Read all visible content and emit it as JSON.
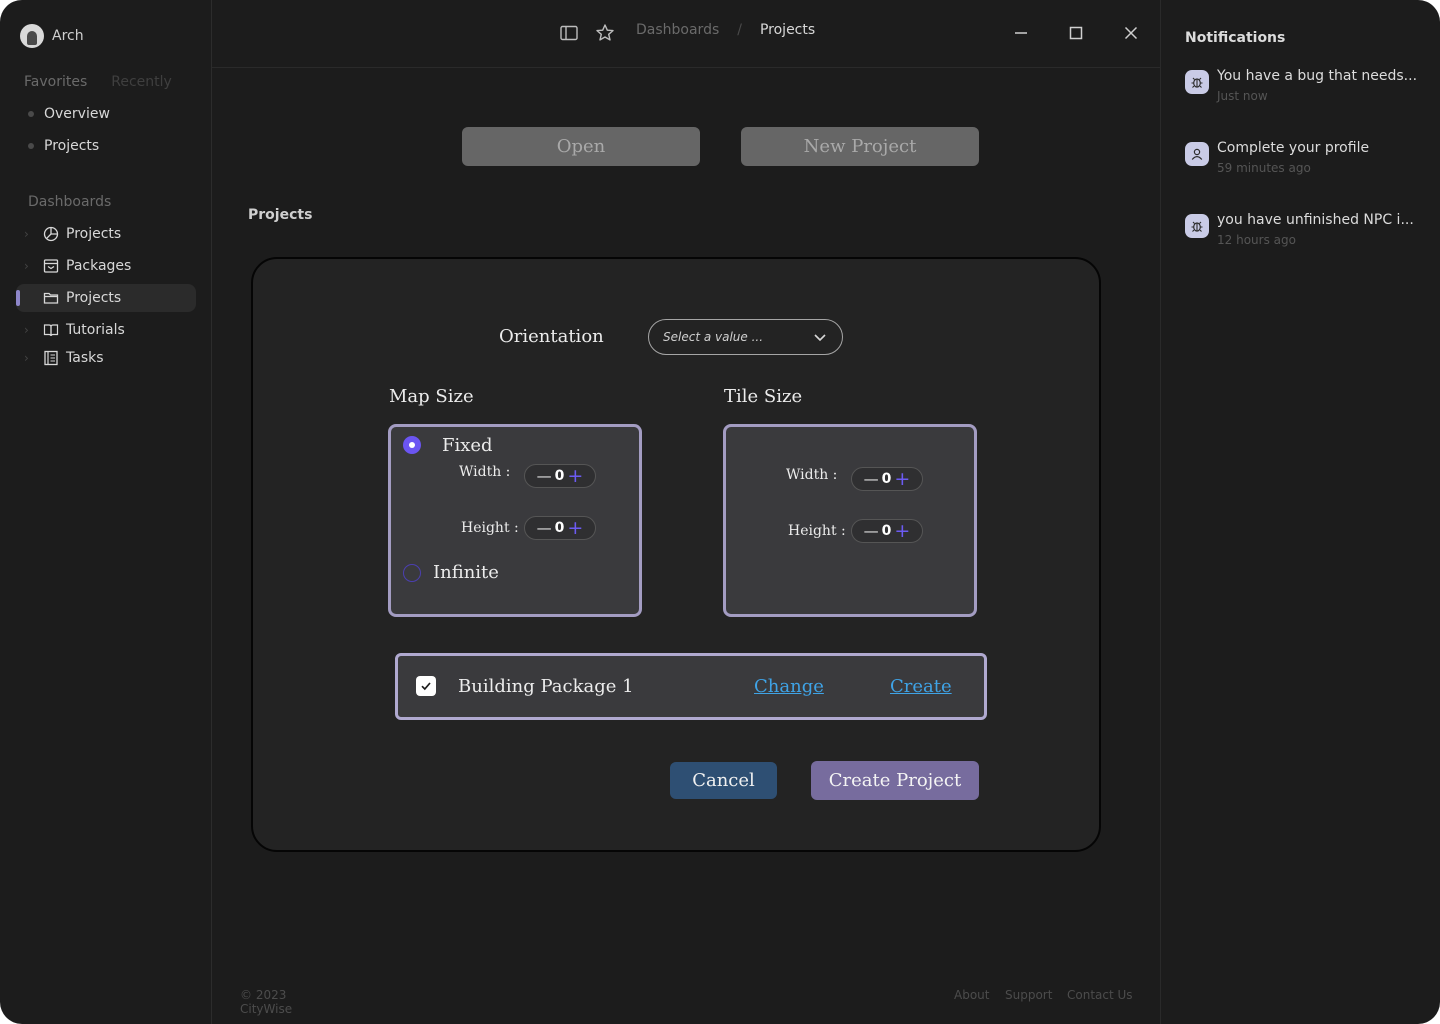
{
  "user": {
    "name": "Arch"
  },
  "sidebar": {
    "tabs": [
      "Favorites",
      "Recently"
    ],
    "favorites": [
      "Overview",
      "Projects"
    ],
    "dashboards_label": "Dashboards",
    "items": [
      {
        "label": "Projects",
        "icon": "pie-chart-icon"
      },
      {
        "label": "Packages",
        "icon": "package-icon"
      },
      {
        "label": "Projects",
        "icon": "folder-icon",
        "active": true
      },
      {
        "label": "Tutorials",
        "icon": "book-icon"
      },
      {
        "label": "Tasks",
        "icon": "notebook-icon"
      }
    ]
  },
  "breadcrumb": {
    "parent": "Dashboards",
    "separator": "/",
    "current": "Projects"
  },
  "top_buttons": {
    "open": "Open",
    "new_project": "New Project"
  },
  "section_label": "Projects",
  "form": {
    "orientation_label": "Orientation",
    "orientation_placeholder": "Select a value ...",
    "map_size": {
      "title": "Map Size",
      "fixed_label": "Fixed",
      "fixed_selected": true,
      "width_label": "Width :",
      "width_value": "0",
      "height_label": "Height :",
      "height_value": "0",
      "infinite_label": "Infinite"
    },
    "tile_size": {
      "title": "Tile Size",
      "width_label": "Width :",
      "width_value": "0",
      "height_label": "Height :",
      "height_value": "0"
    },
    "package": {
      "checked": true,
      "name": "Building Package 1",
      "change_label": "Change",
      "create_label": "Create"
    },
    "cancel_label": "Cancel",
    "create_label": "Create Project"
  },
  "notifications": {
    "title": "Notifications",
    "items": [
      {
        "text": "You have a bug that needs...",
        "time": "Just now",
        "icon": "bug-icon"
      },
      {
        "text": "Complete your profile",
        "time": "59 minutes ago",
        "icon": "user-icon"
      },
      {
        "text": "you have unfinished NPC i...",
        "time": "12 hours ago",
        "icon": "bug-icon"
      }
    ]
  },
  "footer": {
    "copyright": "© 2023 CityWise",
    "links": [
      "About",
      "Support",
      "Contact Us"
    ]
  },
  "colors": {
    "background": "#1c1c1c",
    "accent_purple": "#6b55f2",
    "box_border": "#a39cc2",
    "link_blue": "#3fa3e6",
    "cancel_bg": "#2e4f73",
    "create_bg": "#776c9e"
  }
}
